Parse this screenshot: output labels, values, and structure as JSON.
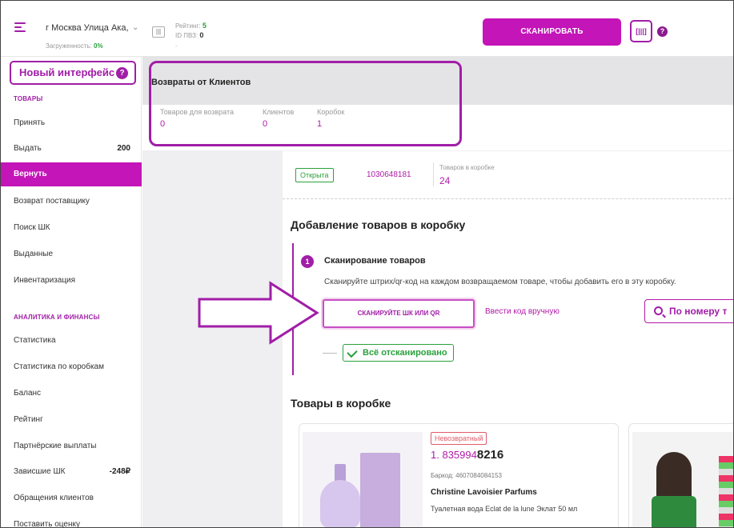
{
  "topbar": {
    "address": "г Москва Улица Ака,",
    "load_label": "Загруженность:",
    "load_value": "0%",
    "barcode_icon": "barcode-icon",
    "rating_label": "Рейтинг:",
    "rating_value": "5",
    "pvz_label": "ID ПВЗ:",
    "pvz_value": "0",
    "pvz_dash": "-",
    "scan_button": "СКАНИРОВАТЬ",
    "qr_button_icon": "qr-scan-icon",
    "help_icon": "help-icon",
    "accent": "#c315b8"
  },
  "sidebar": {
    "new_interface": "Новый интерфейс",
    "section_goods": "ТОВАРЫ",
    "items_goods": [
      {
        "label": "Принять",
        "count": ""
      },
      {
        "label": "Выдать",
        "count": "200"
      },
      {
        "label": "Вернуть",
        "count": ""
      },
      {
        "label": "Возврат поставщику",
        "count": ""
      },
      {
        "label": "Поиск ШК",
        "count": ""
      },
      {
        "label": "Выданные",
        "count": ""
      },
      {
        "label": "Инвентаризация",
        "count": ""
      }
    ],
    "section_analytics": "АНАЛИТИКА И ФИНАНСЫ",
    "items_analytics": [
      {
        "label": "Статистика",
        "count": ""
      },
      {
        "label": "Статистика по коробкам",
        "count": ""
      },
      {
        "label": "Баланс",
        "count": ""
      },
      {
        "label": "Рейтинг",
        "count": ""
      },
      {
        "label": "Партнёрские выплаты",
        "count": ""
      },
      {
        "label": "Зависшие ШК",
        "count": "-248₽"
      },
      {
        "label": "Обращения клиентов",
        "count": ""
      },
      {
        "label": "Поставить оценку",
        "count": ""
      }
    ]
  },
  "header": {
    "title": "Возвраты от Клиентов",
    "stats": [
      {
        "label": "Товаров для возврата",
        "value": "0"
      },
      {
        "label": "Клиентов",
        "value": "0"
      },
      {
        "label": "Коробок",
        "value": "1"
      }
    ]
  },
  "box": {
    "status": "Открыта",
    "id": "1030648181",
    "count_label": "Товаров в коробке",
    "count": "24"
  },
  "add": {
    "title": "Добавление товаров в коробку",
    "step_number": "1",
    "step_title": "Сканирование товаров",
    "step_desc": "Сканируйте штрих/qr-код на каждом возвращаемом товаре, чтобы добавить его в эту коробку.",
    "scan_button": "СКАНИРУЙТЕ ШК ИЛИ QR",
    "manual_link": "Ввести код вручную",
    "search_button": "По номеру т",
    "scanned_chip": "Всё отсканировано"
  },
  "goods": {
    "title": "Товары в коробке",
    "items": [
      {
        "badge": "Невозвратный",
        "index": "1.",
        "code_prefix": "835994",
        "code_suffix": "8216",
        "barcode_label": "Баркод:",
        "barcode": "4607084084153",
        "brand": "Christine Lavoisier Parfums",
        "name": "Туалетная вода Eclat de la lune Эклат 50 мл"
      }
    ]
  }
}
